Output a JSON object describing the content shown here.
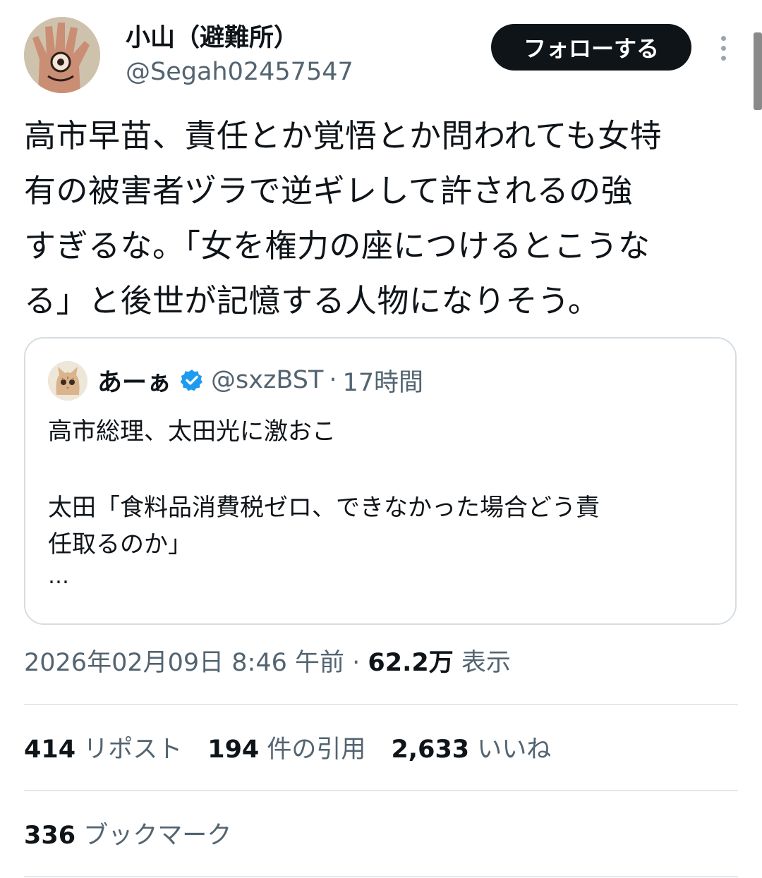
{
  "author": {
    "display_name": "小山（避難所）",
    "handle": "@Segah02457547",
    "avatar_icon": "hand-eye-avatar",
    "follow_label": "フォローする",
    "more_icon": "vertical-ellipsis-icon"
  },
  "tweet": {
    "lines": [
      "高市早苗、責任とか覚悟とか問われても女特",
      "有の被害者ヅラで逆ギレして許されるの強",
      "すぎるな。「女を権力の座につけるとこうな",
      "る」と後世が記憶する人物になりそう。"
    ]
  },
  "quote": {
    "avatar_icon": "kitten-avatar",
    "name": "あーぁ",
    "verified_icon": "verified-badge-icon",
    "handle": "@sxzBST",
    "separator": "·",
    "time": "17時間",
    "body_line1": "高市総理、太田光に激おこ",
    "body_line2a": "太田「食料品消費税ゼロ、できなかった場合どう責",
    "body_line2b": "任取るのか」",
    "ellipsis": "…"
  },
  "meta": {
    "timestamp": "2026年02月09日 8:46 午前",
    "separator": "·",
    "views_count": "62.2万",
    "views_label": "表示"
  },
  "stats": {
    "reposts_count": "414",
    "reposts_label": "リポスト",
    "quotes_count": "194",
    "quotes_label": "件の引用",
    "likes_count": "2,633",
    "likes_label": "いいね",
    "bookmarks_count": "336",
    "bookmarks_label": "ブックマーク"
  },
  "colors": {
    "text_primary": "#0f1419",
    "text_secondary": "#536471",
    "border": "#d6dde2",
    "verified_blue": "#1d9bf0"
  }
}
